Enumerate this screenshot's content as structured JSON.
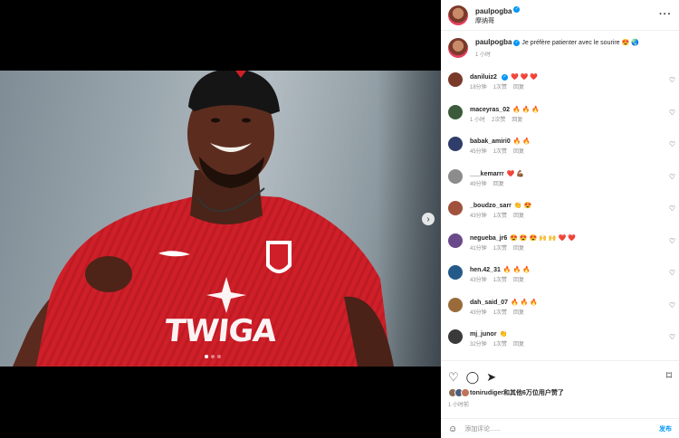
{
  "header": {
    "username": "paulpogba",
    "location": "摩纳哥",
    "more_label": "···",
    "verified_mark": "✓"
  },
  "media": {
    "jersey_text": "TWIGA",
    "next_icon": "›",
    "total_slides": 3,
    "current_slide": 1
  },
  "caption": {
    "username": "paulpogba",
    "text": "Je préfère patienter avec le sourire 😍 🌏",
    "time": "1 小时"
  },
  "comments": [
    {
      "user": "daniluiz2",
      "verified": true,
      "text": "❤️ ❤️ ❤️",
      "time": "18分钟",
      "likes": "1次赞",
      "reply": "回复"
    },
    {
      "user": "maceyras_02",
      "verified": false,
      "text": "🔥 🔥 🔥",
      "time": "1 小时",
      "likes": "2次赞",
      "reply": "回复"
    },
    {
      "user": "babak_amiri0",
      "verified": false,
      "text": "🔥 🔥",
      "time": "45分钟",
      "likes": "1次赞",
      "reply": "回复"
    },
    {
      "user": "___kemarrr",
      "verified": false,
      "text": "❤️ 💪🏾",
      "time": "49分钟",
      "likes": "",
      "reply": "回复"
    },
    {
      "user": "_boudzo_sarr",
      "verified": false,
      "text": "👏 😍",
      "time": "43分钟",
      "likes": "1次赞",
      "reply": "回复"
    },
    {
      "user": "negueba_jr6",
      "verified": false,
      "text": "😍 😍 😍 🙌 🙌 ❤️ ❤️",
      "time": "41分钟",
      "likes": "1次赞",
      "reply": "回复"
    },
    {
      "user": "hen.42_31",
      "verified": false,
      "text": "🔥 🔥 🔥",
      "time": "43分钟",
      "likes": "1次赞",
      "reply": "回复"
    },
    {
      "user": "dah_said_07",
      "verified": false,
      "text": "🔥 🔥 🔥",
      "time": "43分钟",
      "likes": "1次赞",
      "reply": "回复"
    },
    {
      "user": "mj_junor",
      "verified": false,
      "text": "👏",
      "time": "32分钟",
      "likes": "1次赞",
      "reply": "回复"
    }
  ],
  "comment_like_icon": "♡",
  "actions": {
    "like_icon": "♡",
    "comment_icon": "◯",
    "share_icon": "➤",
    "save_icon": "⌑",
    "likes_text": "tonirudiger和其他6万位用户赞了",
    "time": "1 小时前"
  },
  "add_comment": {
    "emoji_icon": "☺",
    "placeholder": "添加评论......",
    "post_label": "发布"
  },
  "colors": {
    "accent": "#0095f6",
    "jersey_red": "#d0202a"
  }
}
